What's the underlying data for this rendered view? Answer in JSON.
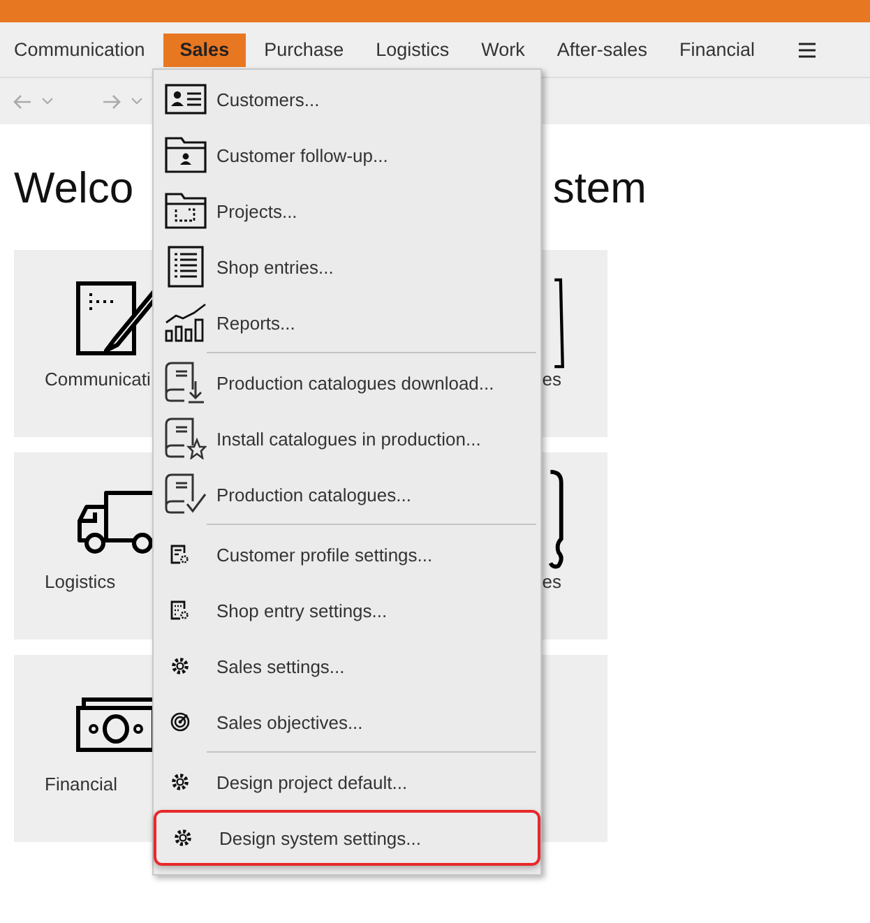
{
  "menu_bar": {
    "items": [
      {
        "label": "Communication",
        "selected": false
      },
      {
        "label": "Sales",
        "selected": true
      },
      {
        "label": "Purchase",
        "selected": false
      },
      {
        "label": "Logistics",
        "selected": false
      },
      {
        "label": "Work",
        "selected": false
      },
      {
        "label": "After-sales",
        "selected": false
      },
      {
        "label": "Financial",
        "selected": false
      }
    ]
  },
  "page": {
    "title_left": "Welco",
    "title_right": "stem",
    "tiles": [
      {
        "label": "Communicati"
      },
      {
        "label": "es"
      },
      {
        "label": "Logistics"
      },
      {
        "label": "es"
      },
      {
        "label": "Financial"
      }
    ]
  },
  "dropdown": {
    "items": [
      {
        "label": "Customers...",
        "separator_before": false,
        "selected": false
      },
      {
        "label": "Customer follow-up...",
        "separator_before": false,
        "selected": false
      },
      {
        "label": "Projects...",
        "separator_before": false,
        "selected": false
      },
      {
        "label": "Shop entries...",
        "separator_before": false,
        "selected": false
      },
      {
        "label": "Reports...",
        "separator_before": false,
        "selected": false
      },
      {
        "label": "Production catalogues download...",
        "separator_before": true,
        "selected": false
      },
      {
        "label": "Install catalogues in production...",
        "separator_before": false,
        "selected": false
      },
      {
        "label": "Production catalogues...",
        "separator_before": false,
        "selected": false
      },
      {
        "label": "Customer profile settings...",
        "separator_before": true,
        "selected": false
      },
      {
        "label": "Shop entry settings...",
        "separator_before": false,
        "selected": false
      },
      {
        "label": "Sales settings...",
        "separator_before": false,
        "selected": false
      },
      {
        "label": "Sales objectives...",
        "separator_before": false,
        "selected": false
      },
      {
        "label": "Design project default...",
        "separator_before": true,
        "selected": false
      },
      {
        "label": "Design system settings...",
        "separator_before": false,
        "selected": true
      }
    ]
  }
}
